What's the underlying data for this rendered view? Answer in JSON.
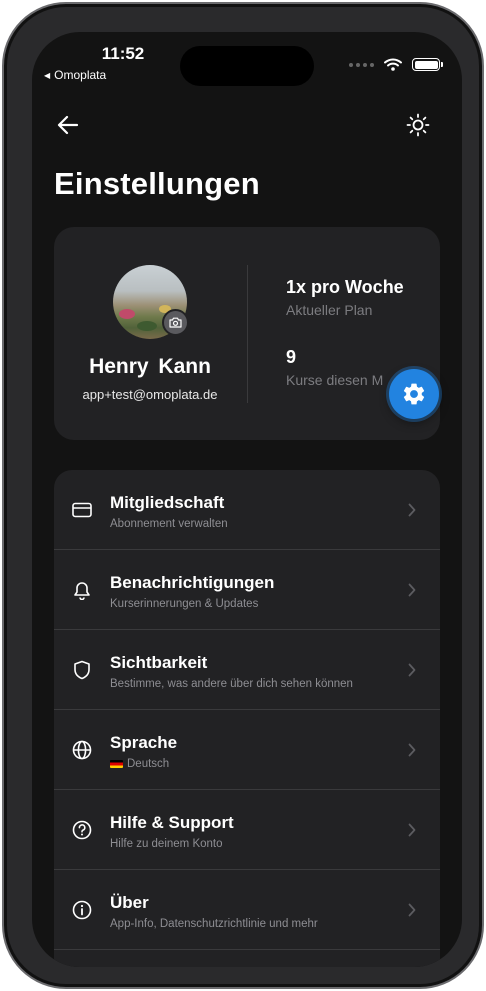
{
  "status_bar": {
    "time": "11:52",
    "back_app": "Omoplata"
  },
  "header": {
    "title": "Einstellungen",
    "back_icon": "arrow-left-icon",
    "theme_icon": "sun-icon"
  },
  "profile": {
    "name": "Henry  Kann",
    "email": "app+test@omoplata.de",
    "stats": [
      {
        "value": "1x pro Woche",
        "label": "Aktueller Plan"
      },
      {
        "value": "9",
        "label": "Kurse diesen M"
      }
    ]
  },
  "fab": {
    "icon": "gear-icon",
    "color": "#2283e0"
  },
  "settings": [
    {
      "title": "Mitgliedschaft",
      "subtitle": "Abonnement verwalten",
      "icon": "credit-card-icon"
    },
    {
      "title": "Benachrichtigungen",
      "subtitle": "Kurserinnerungen & Updates",
      "icon": "bell-icon"
    },
    {
      "title": "Sichtbarkeit",
      "subtitle": "Bestimme, was andere über dich sehen können",
      "icon": "shield-icon"
    },
    {
      "title": "Sprache",
      "subtitle": "Deutsch",
      "icon": "globe-icon"
    },
    {
      "title": "Hilfe & Support",
      "subtitle": "Hilfe zu deinem Konto",
      "icon": "question-circle-icon"
    },
    {
      "title": "Über",
      "subtitle": "App-Info, Datenschutzrichtlinie und mehr",
      "icon": "info-circle-icon"
    }
  ]
}
